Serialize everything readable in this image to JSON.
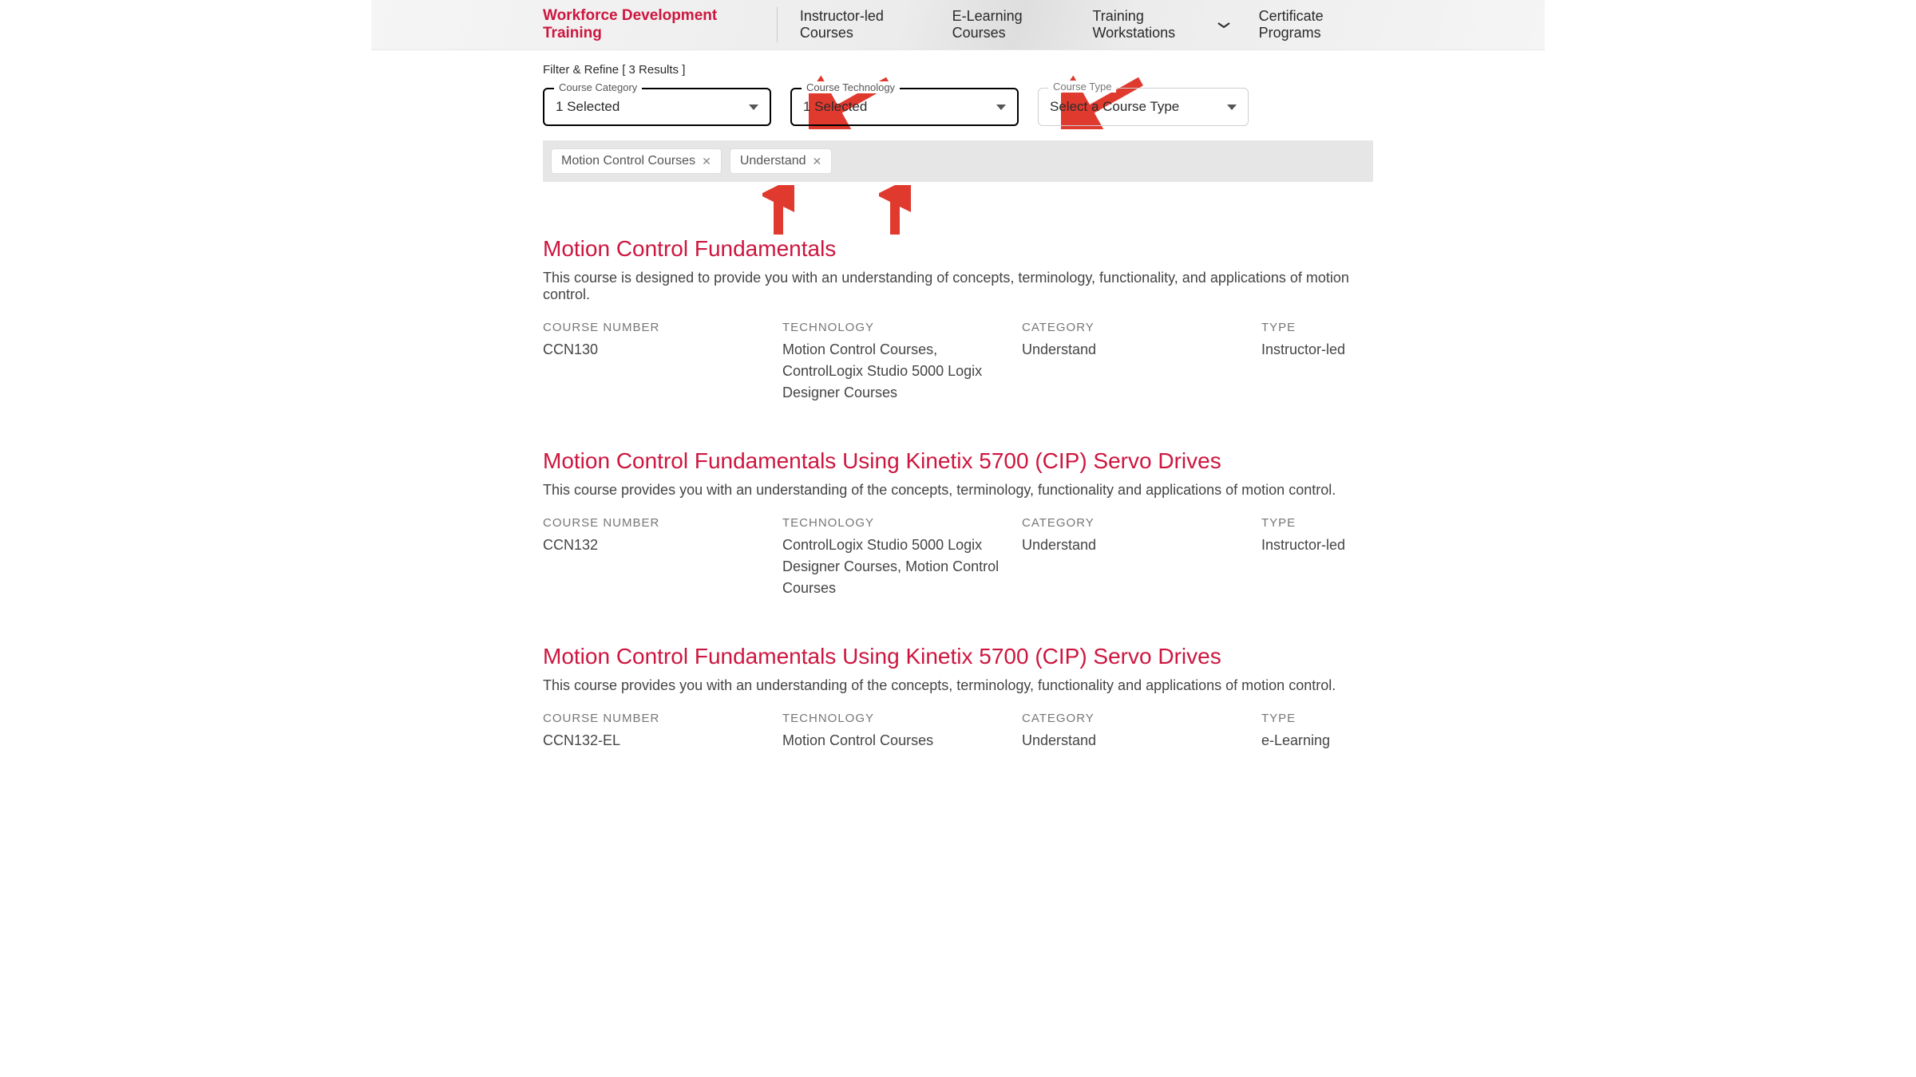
{
  "nav": {
    "active": "Workforce Development Training",
    "items": [
      {
        "label": "Instructor-led Courses",
        "has_chevron": false
      },
      {
        "label": "E-Learning Courses",
        "has_chevron": false
      },
      {
        "label": "Training Workstations",
        "has_chevron": true
      },
      {
        "label": "Certificate Programs",
        "has_chevron": false
      }
    ]
  },
  "filter_header": "Filter & Refine [ 3 Results ]",
  "filters": [
    {
      "legend": "Course Category",
      "value": "1 Selected",
      "strong": true
    },
    {
      "legend": "Course Technology",
      "value": "1 Selected",
      "strong": true
    },
    {
      "legend": "Course Type",
      "value": "Select a Course Type",
      "strong": false
    }
  ],
  "chips": [
    {
      "label": "Motion Control Courses"
    },
    {
      "label": "Understand"
    }
  ],
  "meta_labels": {
    "number": "COURSE NUMBER",
    "technology": "TECHNOLOGY",
    "category": "CATEGORY",
    "type": "TYPE"
  },
  "courses": [
    {
      "title": "Motion Control Fundamentals",
      "desc": "This course is designed to provide you with an understanding of concepts, terminology, functionality, and applications of motion control.",
      "number": "CCN130",
      "technology": "Motion Control Courses, ControlLogix Studio 5000 Logix Designer Courses",
      "category": "Understand",
      "type": "Instructor-led"
    },
    {
      "title": "Motion Control Fundamentals Using Kinetix 5700 (CIP) Servo Drives",
      "desc": "This course provides you with an understanding of the concepts, terminology, functionality and applications of motion control.",
      "number": "CCN132",
      "technology": "ControlLogix Studio 5000 Logix Designer Courses, Motion Control Courses",
      "category": "Understand",
      "type": "Instructor-led"
    },
    {
      "title": "Motion Control Fundamentals Using Kinetix 5700 (CIP) Servo Drives",
      "desc": "This course provides you with an understanding of the concepts, terminology, functionality and applications of motion control.",
      "number": "CCN132-EL",
      "technology": "Motion Control Courses",
      "category": "Understand",
      "type": "e-Learning"
    }
  ]
}
